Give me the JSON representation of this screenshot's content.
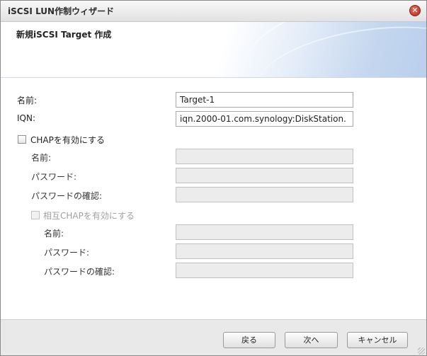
{
  "window": {
    "title": "iSCSI LUN作制ウィザード",
    "close_icon": "close-icon"
  },
  "header": {
    "title": "新規iSCSI Target 作成"
  },
  "form": {
    "name_label": "名前:",
    "name_value": "Target-1",
    "iqn_label": "IQN:",
    "iqn_value": "iqn.2000-01.com.synology:DiskStation.",
    "chap": {
      "label": "CHAPを有効にする",
      "checked": false,
      "name_label": "名前:",
      "password_label": "パスワード:",
      "password_confirm_label": "パスワードの確認:",
      "name_value": "",
      "password_value": "",
      "password_confirm_value": ""
    },
    "mutual_chap": {
      "label": "相互CHAPを有効にする",
      "checked": false,
      "name_label": "名前:",
      "password_label": "パスワード:",
      "password_confirm_label": "パスワードの確認:",
      "name_value": "",
      "password_value": "",
      "password_confirm_value": ""
    }
  },
  "footer": {
    "back_label": "戻る",
    "next_label": "次へ",
    "cancel_label": "キャンセル"
  }
}
